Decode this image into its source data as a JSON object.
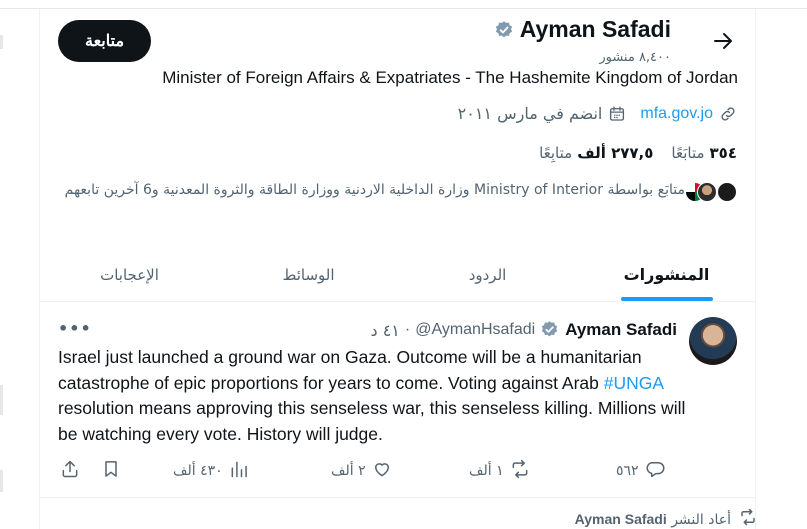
{
  "profile": {
    "name": "Ayman Safadi",
    "posts_count": "٨,٤٠٠ منشور",
    "follow_label": "متابعة",
    "bio": "Minister of Foreign Affairs & Expatriates - The Hashemite Kingdom of Jordan",
    "website": "mfa.gov.jo",
    "joined": "انضم في مارس ٢٠١١",
    "following_count": "٣٥٤",
    "following_label": "متابَعًا",
    "followers_count": "٢٧٧,٥ ألف",
    "followers_label": "متابِعًا",
    "followed_by": "متابَع بواسطة Ministry of Interior وزارة الداخلية الاردنية ووزارة الطاقة والثروة المعدنية و6 آخرين تابعهم"
  },
  "tabs": [
    {
      "label": "المنشورات"
    },
    {
      "label": "الردود"
    },
    {
      "label": "الوسائط"
    },
    {
      "label": "الإعجابات"
    }
  ],
  "tweet": {
    "name": "Ayman Safadi",
    "handle": "@AymanHsafadi",
    "separator": "·",
    "time": "٤١ د",
    "text_before": "Israel just launched a ground war on Gaza. Outcome will be a humanitarian catastrophe of epic proportions for years to come. Voting against Arab ",
    "hashtag": "#UNGA",
    "text_after": " resolution means approving this senseless war, this senseless killing. Millions will be watching every vote. History will judge.",
    "replies": "٥٦٢",
    "retweets": "١ ألف",
    "likes": "٢ ألف",
    "views": "٤٣٠ ألف"
  },
  "retweet_notice": {
    "name": "Ayman Safadi",
    "label": "أعاد النشر"
  },
  "colors": {
    "accent": "#1d9bf0",
    "text": "#0f1419",
    "muted": "#536471"
  }
}
